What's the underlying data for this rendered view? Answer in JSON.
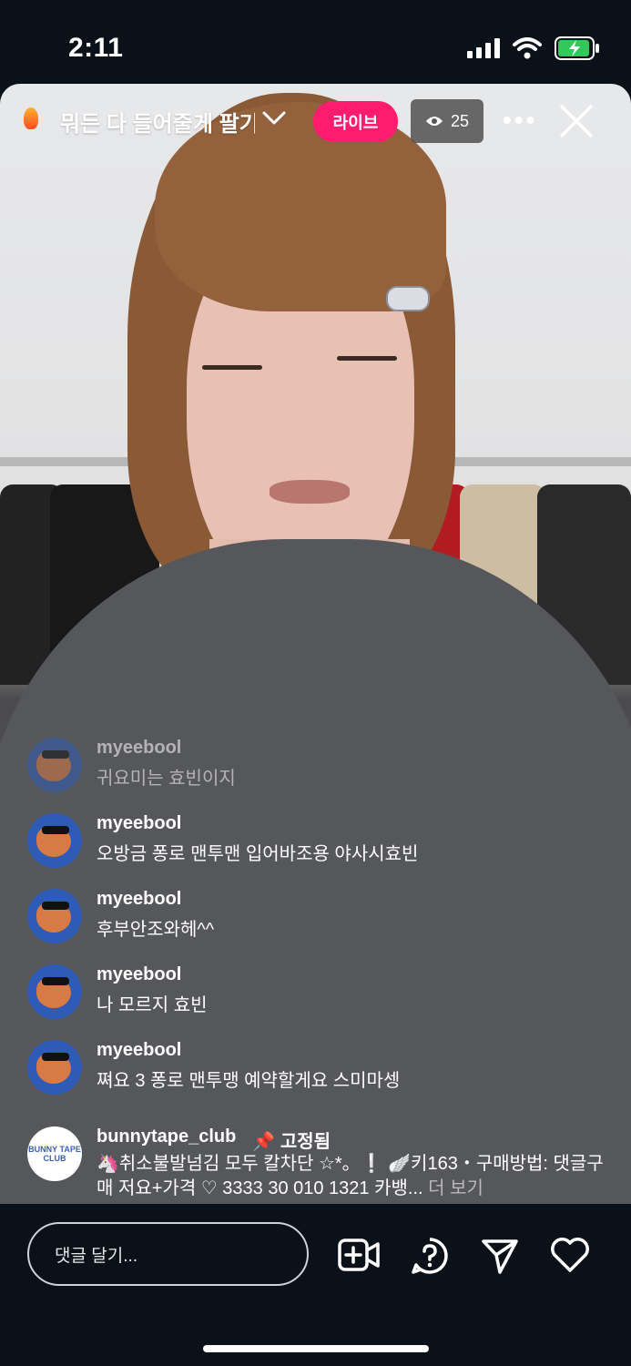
{
  "status_bar": {
    "time": "2:11"
  },
  "live_header": {
    "title": "뭐든 다 들어줄게 팔기",
    "live_label": "라이브",
    "viewer_count": "25"
  },
  "comments": [
    {
      "user": "myeebool",
      "text": "귀요미는 효빈이지",
      "faded": true
    },
    {
      "user": "myeebool",
      "text": "오방금 퐁로 맨투맨 입어바조용 야사시효빈"
    },
    {
      "user": "myeebool",
      "text": "후부안조와헤^^"
    },
    {
      "user": "myeebool",
      "text": "나 모르지 효빈"
    },
    {
      "user": "myeebool",
      "text": "쪄요 3 퐁로 맨투맹 예약할게요 스미마셍"
    }
  ],
  "pinned_comment": {
    "user": "bunnytape_club",
    "pinned_label": "고정됨",
    "text": "🦄취소불발넘김 모두 칼차단 ☆*。❕ 🪽키163・구매방법: 댓글구매 저요+가격 ♡ 3333 30 010 1321 카뱅...",
    "more_label": "더 보기",
    "avatar_text": "BUNNY TAPE CLUB"
  },
  "bottom_bar": {
    "comment_placeholder": "댓글 달기..."
  },
  "colors": {
    "live_badge": "#ff1c6e",
    "background": "#0b1118"
  }
}
